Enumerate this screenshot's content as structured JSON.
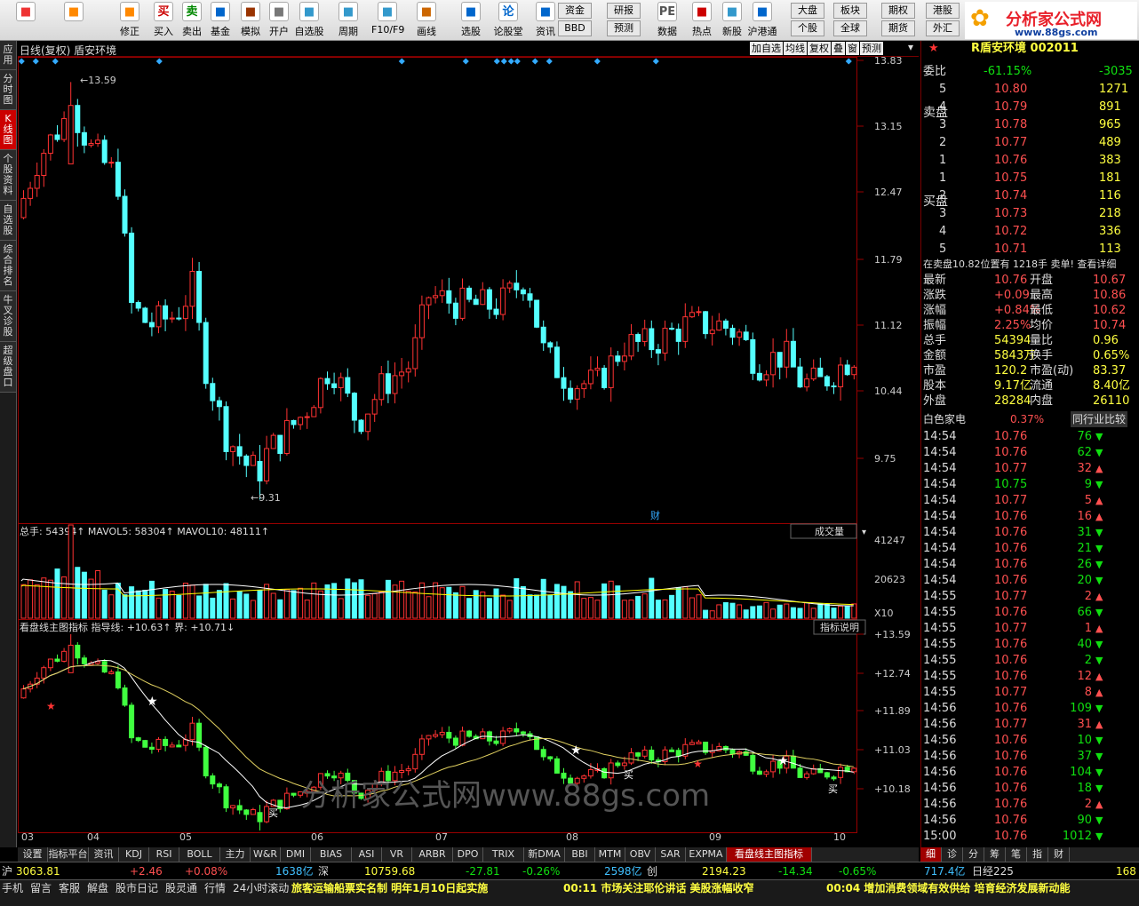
{
  "toolbar": {
    "buttons": [
      {
        "label": "",
        "icon": "windows-icon"
      },
      {
        "label": "",
        "icon": "back-arrow-icon"
      },
      {
        "label": "修正",
        "icon": "fix-icon"
      },
      {
        "label": "买入",
        "icon": "buy-icon"
      },
      {
        "label": "卖出",
        "icon": "sell-icon"
      },
      {
        "label": "基金",
        "icon": "fund-icon"
      },
      {
        "label": "模拟",
        "icon": "hammer-icon"
      },
      {
        "label": "开户",
        "icon": "lock-icon"
      },
      {
        "label": "自选股",
        "icon": "star-icon"
      },
      {
        "label": "周期",
        "icon": "clock-icon"
      },
      {
        "label": "F10/F9",
        "icon": "f10-icon"
      },
      {
        "label": "画线",
        "icon": "pencil-icon"
      },
      {
        "label": "选股",
        "icon": "monitor-icon"
      },
      {
        "label": "论股堂",
        "icon": "forum-icon"
      },
      {
        "label": "资讯",
        "icon": "news-icon"
      },
      {
        "label": "数据",
        "icon": "pe-icon"
      },
      {
        "label": "热点",
        "icon": "hot-icon"
      },
      {
        "label": "新股",
        "icon": "newstock-icon"
      },
      {
        "label": "沪港通",
        "icon": "hkconnect-icon"
      }
    ],
    "small": [
      "资金",
      "BBD",
      "研报",
      "预测",
      "大盘",
      "个股",
      "板块",
      "全球",
      "期权",
      "期货",
      "港股",
      "外汇"
    ],
    "ic_chars": {
      "buy": "买",
      "sell": "卖",
      "forum": "论",
      "pe": "PE"
    }
  },
  "logo": {
    "title": "分析家公式网",
    "url": "www.88gs.com"
  },
  "leftnav": [
    "应用",
    "分时图",
    "K线图",
    "个股资料",
    "自选股",
    "综合排名",
    "牛叉诊股",
    "超级盘口"
  ],
  "chart_header": {
    "title": "日线(复权)  盾安环境",
    "buttons": [
      "加自选",
      "均线",
      "复权",
      "叠",
      "窗",
      "预测"
    ]
  },
  "price_axis": [
    "13.83",
    "13.15",
    "12.47",
    "11.79",
    "11.12",
    "10.44",
    "9.75"
  ],
  "price_annotations": {
    "high": "13.59",
    "low": "9.31",
    "fin": "财"
  },
  "volume_panel": {
    "label": "总手: 54394↑ MAVOL5: 58304↑ MAVOL10: 48111↑",
    "dropdown": "成交量",
    "axis": [
      "41247",
      "20623"
    ],
    "unit": "X10"
  },
  "indicator_panel": {
    "label": "看盘线主图指标  指导线: +10.63↑ 界: +10.71↓",
    "button": "指标说明",
    "axis": [
      "+13.59",
      "+12.74",
      "+11.89",
      "+11.03",
      "+10.18"
    ],
    "buy_label": "买",
    "watermark": "分析家公式网www.88gs.com"
  },
  "dates": [
    "03",
    "04",
    "05",
    "06",
    "07",
    "08",
    "09",
    "10"
  ],
  "tabs": [
    "设置",
    "指标平台",
    "资讯",
    "KDJ",
    "RSI",
    "BOLL",
    "主力",
    "W&R",
    "DMI",
    "BIAS",
    "ASI",
    "VR",
    "ARBR",
    "DPO",
    "TRIX",
    "新DMA",
    "BBI",
    "MTM",
    "OBV",
    "SAR",
    "EXPMA",
    "看盘线主图指标"
  ],
  "right_tabs": [
    "细",
    "诊",
    "分",
    "筹",
    "笔",
    "指",
    "财"
  ],
  "quote": {
    "stock_title": "R盾安环境 002011",
    "weibi": "委比",
    "weibi_val": "-61.15%",
    "weibi_diff": "-3035",
    "sell_label": "卖盘",
    "buy_label": "买盘",
    "sell": [
      [
        "5",
        "10.80",
        "1271"
      ],
      [
        "4",
        "10.79",
        "891"
      ],
      [
        "3",
        "10.78",
        "965"
      ],
      [
        "2",
        "10.77",
        "489"
      ],
      [
        "1",
        "10.76",
        "383"
      ]
    ],
    "buy": [
      [
        "1",
        "10.75",
        "181"
      ],
      [
        "2",
        "10.74",
        "116"
      ],
      [
        "3",
        "10.73",
        "218"
      ],
      [
        "4",
        "10.72",
        "336"
      ],
      [
        "5",
        "10.71",
        "113"
      ]
    ],
    "notice": "在卖盘10.82位置有 1218手 卖单! 查看详细",
    "stats": [
      [
        "最新",
        "10.76",
        "开盘",
        "10.67"
      ],
      [
        "涨跌",
        "+0.09",
        "最高",
        "10.86"
      ],
      [
        "涨幅",
        "+0.84%",
        "最低",
        "10.62"
      ],
      [
        "振幅",
        "2.25%",
        "均价",
        "10.74"
      ],
      [
        "总手",
        "54394",
        "量比",
        "0.96"
      ],
      [
        "金额",
        "5843万",
        "换手",
        "0.65%"
      ],
      [
        "市盈",
        "120.2",
        "市盈(动)",
        "83.37"
      ],
      [
        "股本",
        "9.17亿",
        "流通",
        "8.40亿"
      ],
      [
        "外盘",
        "28284",
        "内盘",
        "26110"
      ]
    ],
    "sector": "白色家电",
    "sector_pct": "0.37%",
    "sector_btn": "同行业比较"
  },
  "ticks": [
    [
      "14:54",
      "10.76",
      "76",
      "d"
    ],
    [
      "14:54",
      "10.76",
      "62",
      "d"
    ],
    [
      "14:54",
      "10.77",
      "32",
      "u"
    ],
    [
      "14:54",
      "10.75",
      "9",
      "d"
    ],
    [
      "14:54",
      "10.77",
      "5",
      "u"
    ],
    [
      "14:54",
      "10.76",
      "16",
      "u"
    ],
    [
      "14:54",
      "10.76",
      "31",
      "d"
    ],
    [
      "14:54",
      "10.76",
      "21",
      "d"
    ],
    [
      "14:54",
      "10.76",
      "26",
      "d"
    ],
    [
      "14:54",
      "10.76",
      "20",
      "d"
    ],
    [
      "14:55",
      "10.77",
      "2",
      "u"
    ],
    [
      "14:55",
      "10.76",
      "66",
      "d"
    ],
    [
      "14:55",
      "10.77",
      "1",
      "u"
    ],
    [
      "14:55",
      "10.76",
      "40",
      "d"
    ],
    [
      "14:55",
      "10.76",
      "2",
      "d"
    ],
    [
      "14:55",
      "10.76",
      "12",
      "u"
    ],
    [
      "14:55",
      "10.77",
      "8",
      "u"
    ],
    [
      "14:56",
      "10.76",
      "109",
      "d"
    ],
    [
      "14:56",
      "10.77",
      "31",
      "u"
    ],
    [
      "14:56",
      "10.76",
      "10",
      "d"
    ],
    [
      "14:56",
      "10.76",
      "37",
      "d"
    ],
    [
      "14:56",
      "10.76",
      "104",
      "d"
    ],
    [
      "14:56",
      "10.76",
      "18",
      "d"
    ],
    [
      "14:56",
      "10.76",
      "2",
      "u"
    ],
    [
      "14:56",
      "10.76",
      "90",
      "d"
    ],
    [
      "15:00",
      "10.76",
      "1012",
      "d"
    ]
  ],
  "status": {
    "sh": "沪",
    "sh_val": "3063.81",
    "sh_chg": "+2.46",
    "sh_pct": "+0.08%",
    "sh_amt": "1638亿",
    "sz": "深",
    "sz_val": "10759.68",
    "sz_chg": "-27.81",
    "sz_pct": "-0.26%",
    "sz_amt": "2598亿",
    "cy": "创",
    "cy_val": "2194.23",
    "cy_chg": "-14.34",
    "cy_pct": "-0.65%",
    "cy_amt": "717.4亿",
    "rj": "日经225",
    "rj_val": "168"
  },
  "bottom": {
    "items": [
      "手机",
      "留言",
      "客服",
      "解盘",
      "股市日记",
      "股灵通",
      "行情",
      "24小时滚动"
    ],
    "news1": "旅客运输船票实名制 明年1月10日起实施",
    "news2": "00:11 市场关注耶伦讲话 美股涨幅收窄",
    "news3": "00:04 增加消费领域有效供给 培育经济发展新动能"
  }
}
